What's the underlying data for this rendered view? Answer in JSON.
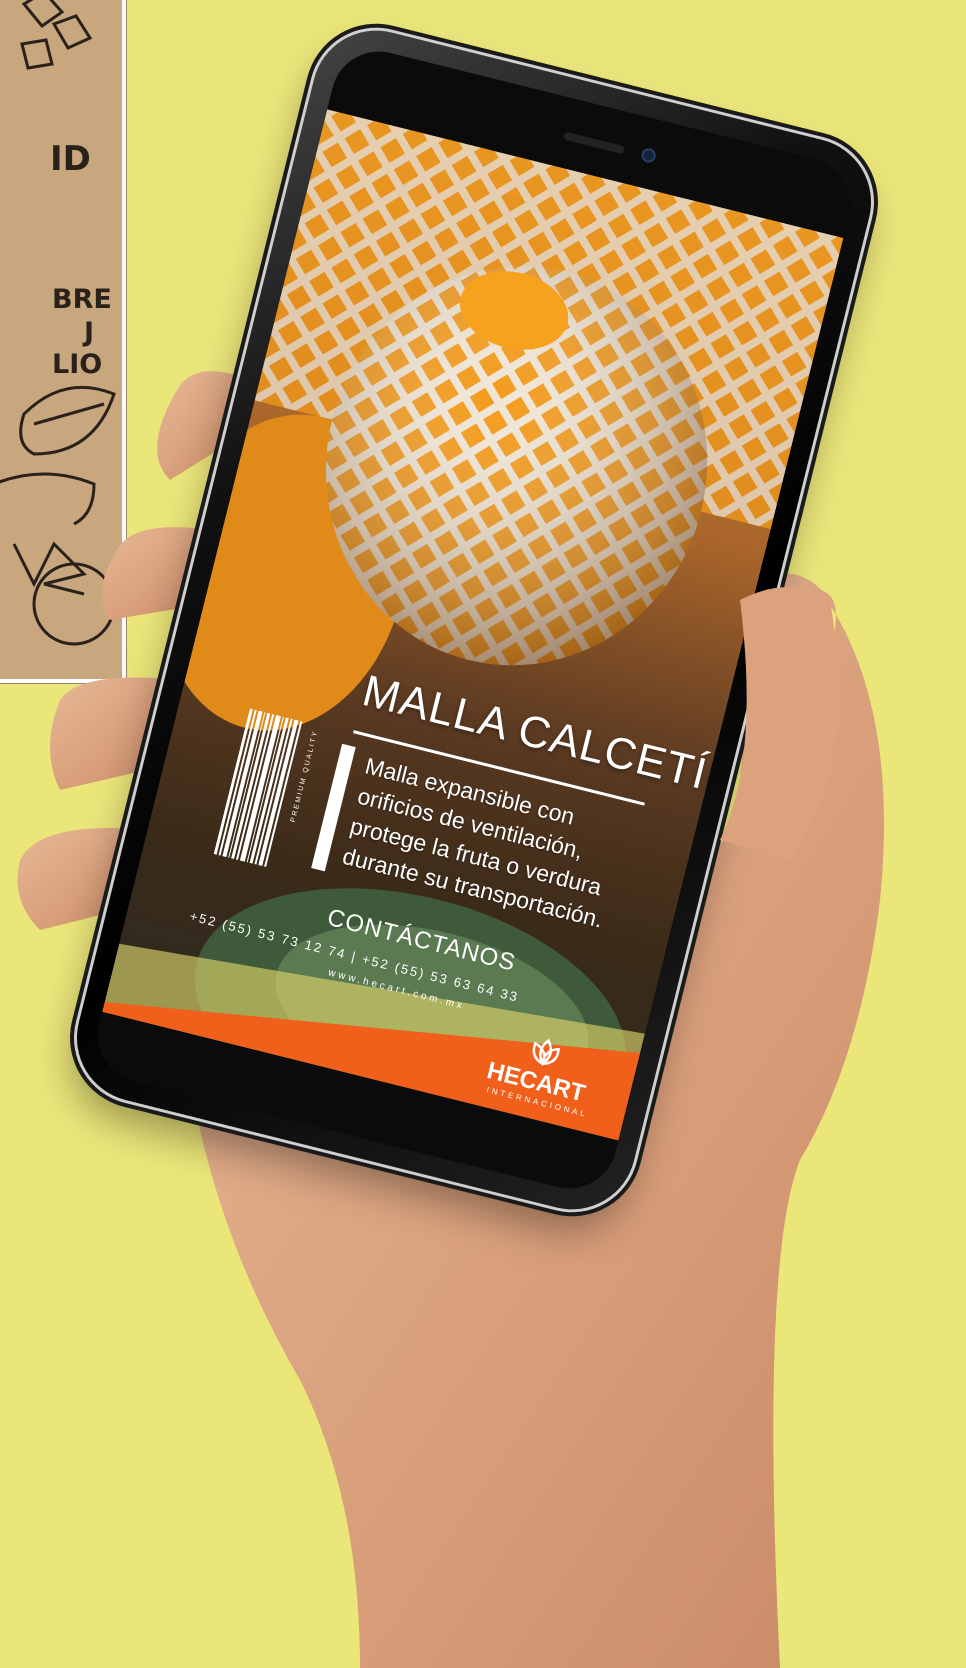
{
  "background_color": "#ebe67a",
  "kraft_card": {
    "line_a": "ID",
    "line_b": "BRE",
    "line_c": "J",
    "line_d": "LIO"
  },
  "screen": {
    "product_title": "MALLA CALCETÍN",
    "description": [
      "Malla expansible con",
      "orificios de ventilación,",
      "protege la fruta o verdura",
      "durante su transportación."
    ],
    "contact_heading": "CONTÁCTANOS",
    "phone_numbers": "+52 (55) 53 73 12 74 | +52 (55) 53 63 64 33",
    "website": "www.hecart.com.mx",
    "barcode_caption": "PREMIUM QUALITY",
    "brand": {
      "name": "HECART",
      "subtitle": "INTERNACIONAL",
      "logo_icon": "flower-mesh-icon"
    },
    "colors": {
      "accent_orange": "#f0601b",
      "mesh_white": "#efe6d6",
      "fruit_orange": "#f39a1a"
    }
  }
}
